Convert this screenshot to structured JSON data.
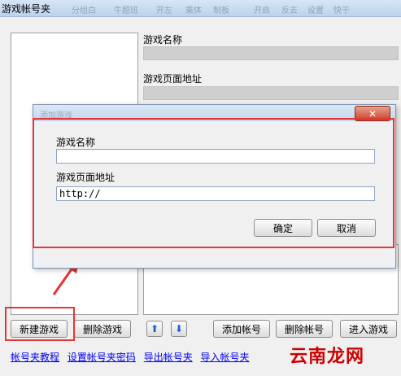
{
  "window": {
    "title": "游戏帐号夹",
    "menu_items": [
      "分组白",
      "牛题班",
      "开左",
      "乘体",
      "制板",
      "开启",
      "反去",
      "设置",
      "快干"
    ]
  },
  "main": {
    "game_name_label": "游戏名称",
    "game_url_label": "游戏页面地址",
    "buttons": {
      "new_game": "新建游戏",
      "delete_game": "删除游戏",
      "up": "⬆",
      "down": "⬇",
      "add_account": "添加帐号",
      "delete_account": "删除帐号",
      "enter_game": "进入游戏"
    },
    "links": [
      "帐号夹教程",
      "设置帐号夹密码",
      "导出帐号夹",
      "导入帐号夹"
    ]
  },
  "dialog": {
    "title": "添加游戏",
    "close_glyph": "✕",
    "game_name_label": "游戏名称",
    "game_name_value": "",
    "game_url_label": "游戏页面地址",
    "game_url_value": "http://",
    "ok": "确定",
    "cancel": "取消"
  },
  "watermark": "云南龙网"
}
